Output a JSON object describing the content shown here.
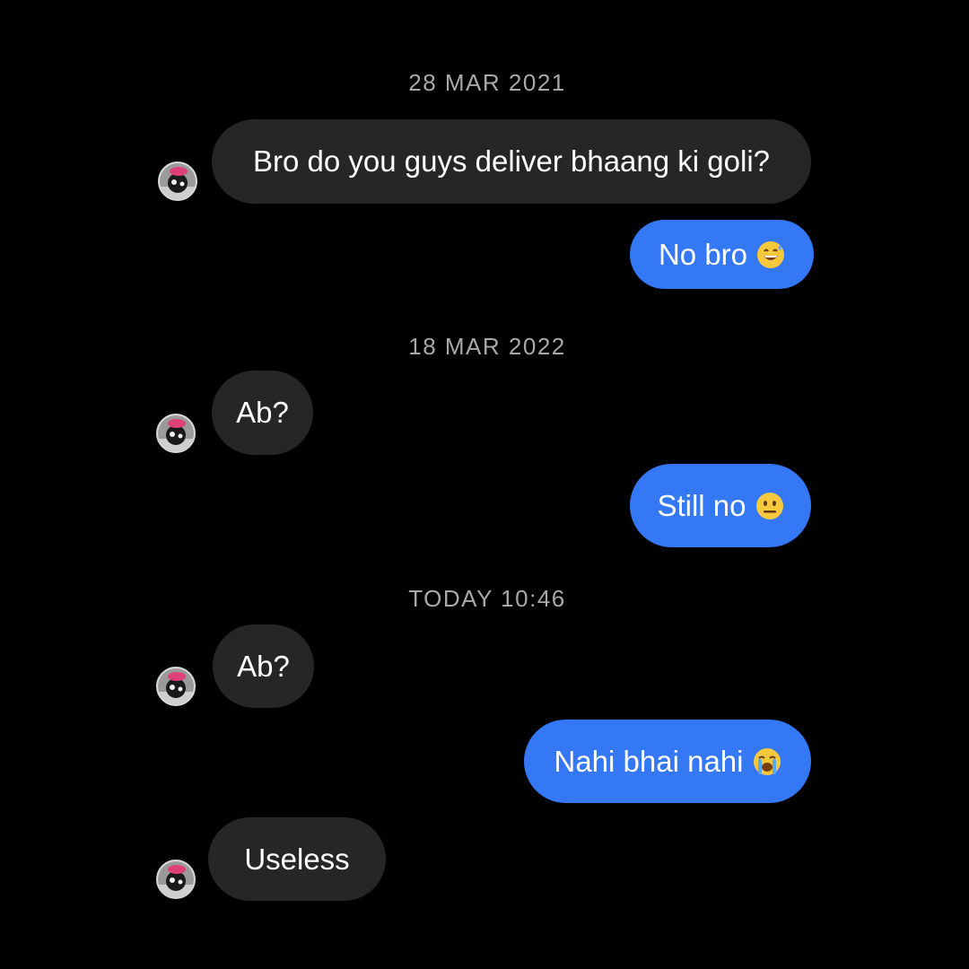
{
  "thread": [
    {
      "type": "timestamp",
      "text": "28 MAR 2021"
    },
    {
      "type": "incoming",
      "text": "Bro do you guys deliver bhaang ki goli?",
      "avatar": "user-avatar"
    },
    {
      "type": "outgoing",
      "text": "No bro",
      "emoji": "grinning-face-with-sweat-icon"
    },
    {
      "type": "timestamp",
      "text": "18 MAR 2022"
    },
    {
      "type": "incoming",
      "text": "Ab?",
      "avatar": "user-avatar"
    },
    {
      "type": "outgoing",
      "text": "Still no",
      "emoji": "neutral-face-icon"
    },
    {
      "type": "timestamp",
      "text": "TODAY 10:46"
    },
    {
      "type": "incoming",
      "text": "Ab?",
      "avatar": "user-avatar"
    },
    {
      "type": "outgoing",
      "text": "Nahi bhai nahi",
      "emoji": "loudly-crying-face-icon"
    },
    {
      "type": "incoming",
      "text": "Useless",
      "avatar": "user-avatar"
    }
  ],
  "colors": {
    "background": "#000000",
    "incoming_bubble": "#262626",
    "outgoing_bubble": "#3478f6",
    "timestamp_text": "#a8a8a8",
    "message_text": "#ffffff"
  }
}
